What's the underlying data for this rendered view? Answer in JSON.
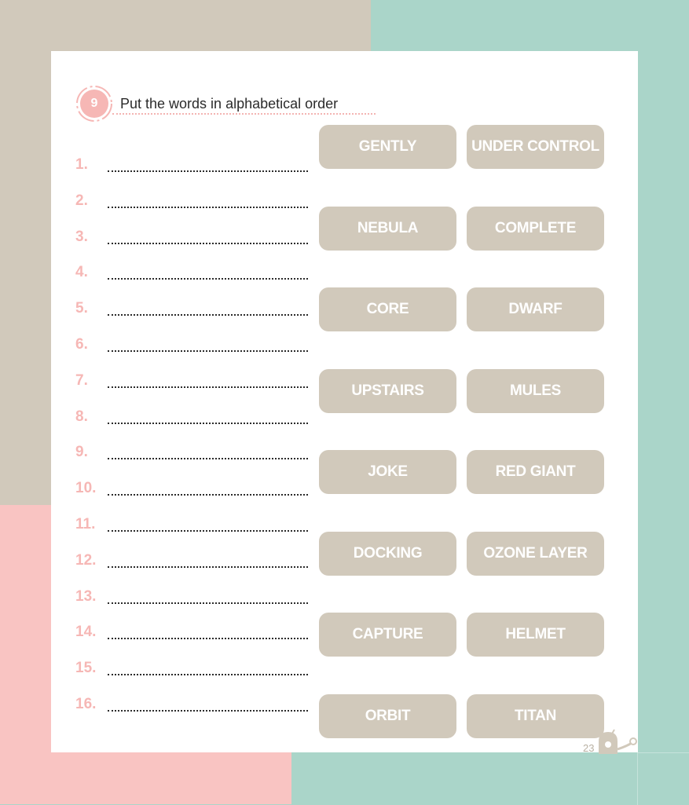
{
  "exercise": {
    "number": "9",
    "instruction": "Put the words in alphabetical order"
  },
  "answer_lines": [
    "1.",
    "2.",
    "3.",
    "4.",
    "5.",
    "6.",
    "7.",
    "8.",
    "9.",
    "10.",
    "11.",
    "12.",
    "13.",
    "14.",
    "15.",
    "16."
  ],
  "words": [
    "GENTLY",
    "UNDER CONTROL",
    "NEBULA",
    "COMPLETE",
    "CORE",
    "DWARF",
    "UPSTAIRS",
    "MULES",
    "JOKE",
    "RED GIANT",
    "DOCKING",
    "OZONE LAYER",
    "CAPTURE",
    "HELMET",
    "ORBIT",
    "TITAN"
  ],
  "page_number": "23",
  "colors": {
    "beige": "#d1c9bb",
    "teal": "#aad5c9",
    "pink": "#f9c4c2",
    "accent_pink": "#f6b7b5"
  },
  "icons": [
    "exercise-number-badge",
    "mascot-icon"
  ]
}
